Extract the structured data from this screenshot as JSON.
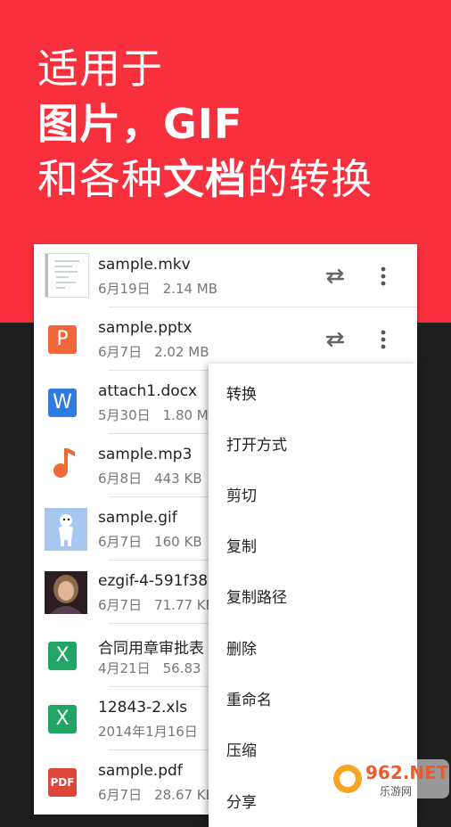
{
  "hero": {
    "line1": "适用于",
    "line2": "图片，GIF",
    "line3_pre": "和各种",
    "line3_bold": "文档",
    "line3_post": "的转换"
  },
  "files": [
    {
      "name": "sample.mkv",
      "date": "6月19日",
      "size": "2.14 MB",
      "icon": "document-thumbnail"
    },
    {
      "name": "sample.pptx",
      "date": "6月7日",
      "size": "2.02 MB",
      "icon": "P",
      "icon_color": "#f0683a"
    },
    {
      "name": "attach1.docx",
      "date": "5月30日",
      "size": "1.80 MB",
      "icon": "W",
      "icon_color": "#2f7be0"
    },
    {
      "name": "sample.mp3",
      "date": "6月8日",
      "size": "443 KB",
      "icon": "music-note-icon",
      "icon_color": "#f0683a"
    },
    {
      "name": "sample.gif",
      "date": "6月7日",
      "size": "160 KB",
      "icon": "gif-thumbnail"
    },
    {
      "name": "ezgif-4-591f38",
      "date": "6月7日",
      "size": "71.77 KB",
      "icon": "photo-thumbnail"
    },
    {
      "name": "合同用章审批表",
      "date": "4月21日",
      "size": "56.83",
      "icon": "X",
      "icon_color": "#21a464"
    },
    {
      "name": "12843-2.xls",
      "date": "2014年1月16日",
      "size": "",
      "icon": "X",
      "icon_color": "#21a464"
    },
    {
      "name": "sample.pdf",
      "date": "6月7日",
      "size": "28.67 KB",
      "icon": "PDF",
      "icon_color": "#e0453a"
    }
  ],
  "menu": {
    "items": [
      "转换",
      "打开方式",
      "剪切",
      "复制",
      "复制路径",
      "删除",
      "重命名",
      "压缩",
      "分享"
    ]
  },
  "watermark": {
    "brand": "962.NET",
    "sub": "乐游网"
  }
}
